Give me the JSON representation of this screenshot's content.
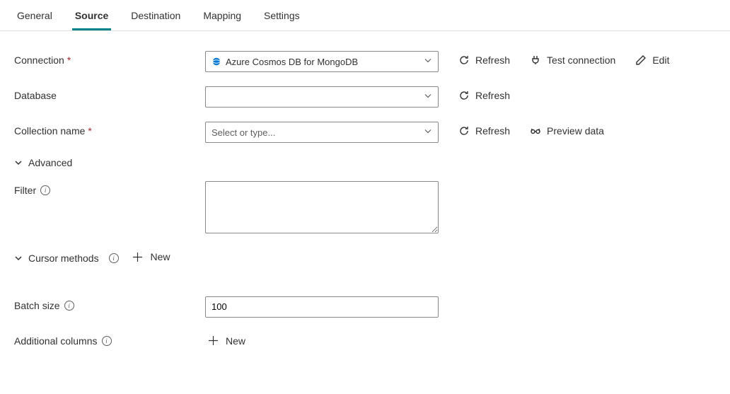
{
  "tabs": {
    "general": "General",
    "source": "Source",
    "destination": "Destination",
    "mapping": "Mapping",
    "settings": "Settings",
    "active": "source"
  },
  "labels": {
    "connection": "Connection",
    "database": "Database",
    "collection_name": "Collection name",
    "advanced": "Advanced",
    "filter": "Filter",
    "cursor_methods": "Cursor methods",
    "new": "New",
    "batch_size": "Batch size",
    "additional_columns": "Additional columns"
  },
  "fields": {
    "connection_value": "Azure Cosmos DB for MongoDB",
    "database_value": "",
    "collection_placeholder": "Select or type...",
    "collection_value": "",
    "filter_value": "",
    "batch_size_value": "100"
  },
  "actions": {
    "refresh": "Refresh",
    "test_connection": "Test connection",
    "edit": "Edit",
    "preview_data": "Preview data"
  }
}
